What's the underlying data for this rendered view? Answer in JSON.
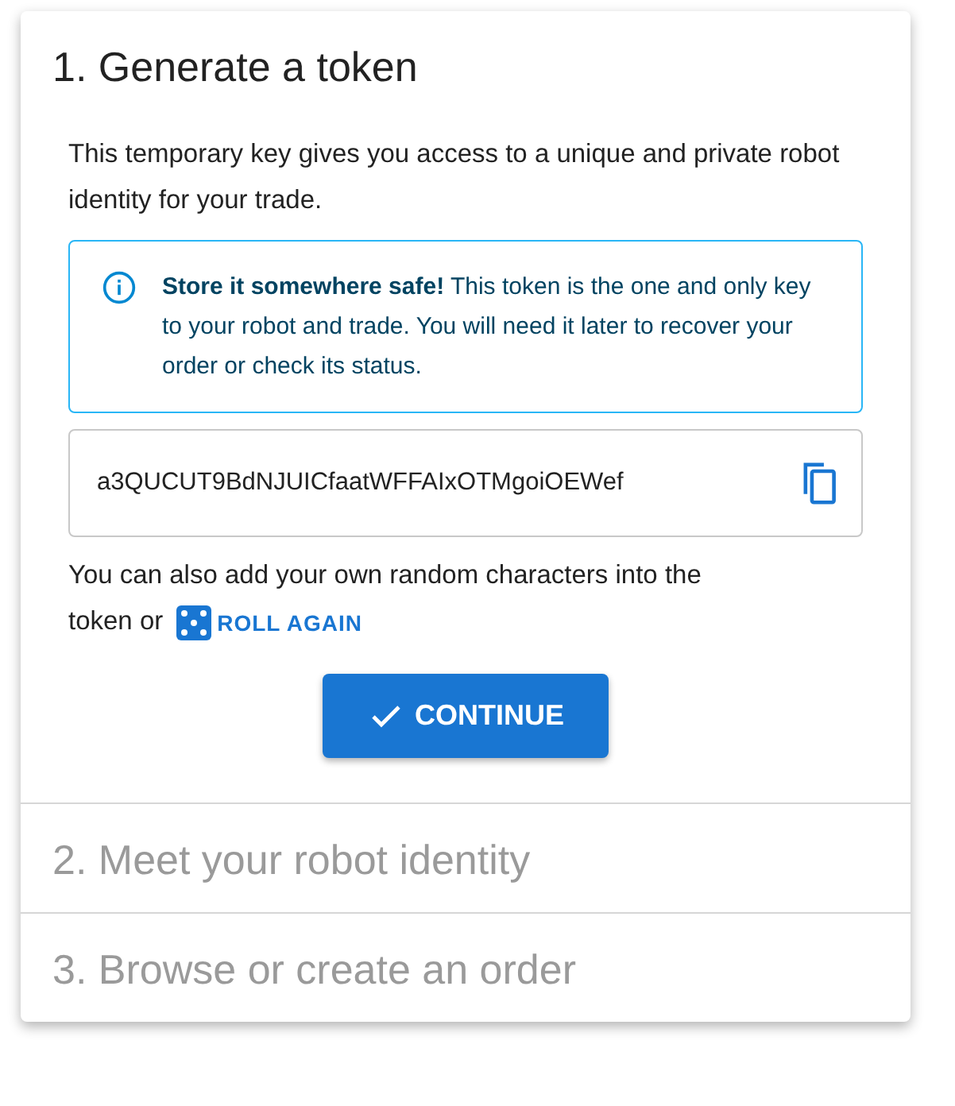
{
  "steps": [
    {
      "title": "1. Generate a token",
      "expanded": true
    },
    {
      "title": "2. Meet your robot identity",
      "expanded": false
    },
    {
      "title": "3. Browse or create an order",
      "expanded": false
    }
  ],
  "intro": "This temporary key gives you access to a unique and private robot identity for your trade.",
  "alert": "**Store it somewhere safe!** This token is the one and only key to your robot and trade. You will need it later to recover your order or check its status.",
  "token": {
    "value": "a3QUCUT9BdNJUICfaatWFFAIxOTMgoiOEWef"
  },
  "hint": [
    "You can also add your own random characters into the",
    "token or"
  ],
  "roll_button": "ROLL AGAIN",
  "continue_button": "CONTINUE"
}
